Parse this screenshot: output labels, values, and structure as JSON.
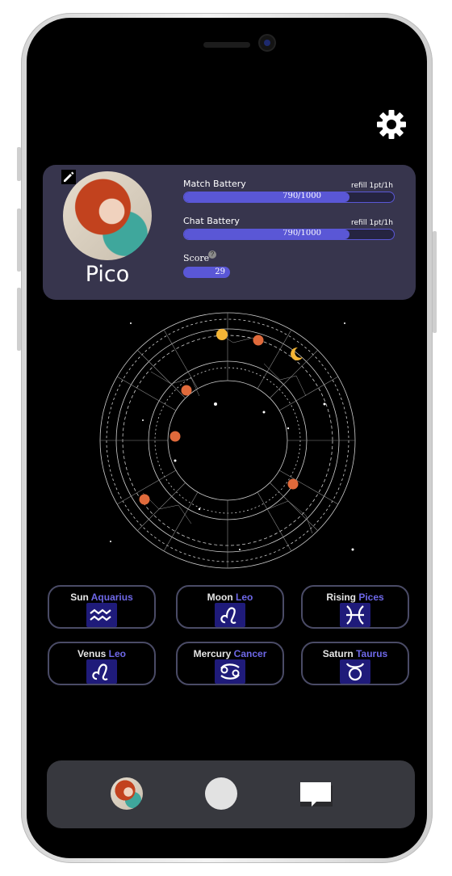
{
  "profile": {
    "name": "Pico",
    "match_battery": {
      "label": "Match Battery",
      "refill": "refill 1pt/1h",
      "value_text": "790/1000",
      "fraction": 0.79
    },
    "chat_battery": {
      "label": "Chat Battery",
      "refill": "refill 1pt/1h",
      "value_text": "790/1000",
      "fraction": 0.79
    },
    "score": {
      "label": "Score",
      "help": "?",
      "value": "29"
    }
  },
  "signs": [
    {
      "planet": "Sun",
      "sign": "Aquarius",
      "icon": "aquarius-icon"
    },
    {
      "planet": "Moon",
      "sign": "Leo",
      "icon": "leo-icon"
    },
    {
      "planet": "Rising",
      "sign": "Pices",
      "icon": "pisces-icon"
    },
    {
      "planet": "Venus",
      "sign": "Leo",
      "icon": "leo-icon"
    },
    {
      "planet": "Mercury",
      "sign": "Cancer",
      "icon": "cancer-icon"
    },
    {
      "planet": "Saturn",
      "sign": "Taurus",
      "icon": "taurus-icon"
    }
  ],
  "colors": {
    "accent": "#5a57d6",
    "card_bg": "#37354d",
    "sign_value": "#6e68e8",
    "nav_bg": "#37383e"
  },
  "icons": {
    "settings": "gear-icon",
    "edit": "pencil-icon",
    "nav": [
      "avatar",
      "home-circle",
      "chat-bubble-icon"
    ]
  }
}
